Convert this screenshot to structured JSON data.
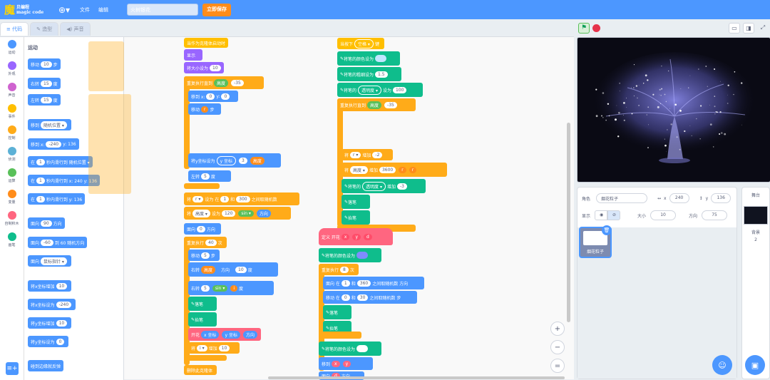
{
  "header": {
    "logo_main": "魔",
    "logo_cn": "贝编程",
    "logo_en": "magic code",
    "menu_file": "文件",
    "menu_edit": "编辑",
    "project_title": "火树银花",
    "save_label": "立即保存"
  },
  "tabs": [
    "代码",
    "造型",
    "声音"
  ],
  "categories": [
    {
      "label": "运动",
      "color": "#4c97ff"
    },
    {
      "label": "外观",
      "color": "#9966ff"
    },
    {
      "label": "声音",
      "color": "#cf63cf"
    },
    {
      "label": "事件",
      "color": "#ffbf00"
    },
    {
      "label": "控制",
      "color": "#ffab19"
    },
    {
      "label": "侦测",
      "color": "#5cb1d6"
    },
    {
      "label": "运算",
      "color": "#59c059"
    },
    {
      "label": "变量",
      "color": "#ff8c1a"
    },
    {
      "label": "自制积木",
      "color": "#ff6680"
    },
    {
      "label": "画笔",
      "color": "#0fbd8c"
    }
  ],
  "palette": {
    "title": "运动",
    "blocks": [
      {
        "t": "移动",
        "v": "10",
        "s": "步"
      },
      {
        "t": "右转",
        "v": "15",
        "s": "度"
      },
      {
        "t": "左转",
        "v": "15",
        "s": "度"
      },
      {
        "t": "移到",
        "v": "随机位置 ▾",
        "s": ""
      },
      {
        "t": "移到 x:",
        "v": "-240",
        "s": "y: 136"
      },
      {
        "t": "在",
        "v": "1",
        "s": "秒内滑行到 随机位置 ▾"
      },
      {
        "t": "在",
        "v": "1",
        "s": "秒内滑行到 x: 240 y: 136"
      },
      {
        "t": "在",
        "v": "1",
        "s": "秒内滑行到 y: 136"
      },
      {
        "t": "面向",
        "v": "90",
        "s": "方向"
      },
      {
        "t": "面向",
        "v": "-60",
        "s": "到 60 随机方向"
      },
      {
        "t": "面向",
        "v": "鼠标指针 ▾",
        "s": ""
      },
      {
        "t": "将x坐标增加",
        "v": "10",
        "s": ""
      },
      {
        "t": "将x坐标设为",
        "v": "-240",
        "s": ""
      },
      {
        "t": "将y坐标增加",
        "v": "10",
        "s": ""
      },
      {
        "t": "将y坐标设为",
        "v": "0",
        "s": ""
      },
      {
        "t": "碰到边缘就反弹",
        "v": "",
        "s": ""
      }
    ]
  },
  "script1": {
    "hat": "当作为克隆体启动时",
    "b1": "显示",
    "b2_t": "将大小设为",
    "b2_v": "10",
    "b3_t": "重复执行直到",
    "b3_v1": "高度",
    "b3_v2": "-35",
    "b4_t": "移到 x:",
    "b4_v1": "0",
    "b4_v2": "y:",
    "b4_v3": "0",
    "b5_t": "移动",
    "b5_v": "r",
    "b5_s": "步",
    "b6_t": "将y坐标设为",
    "b6_v1": "y 坐标",
    "b6_v2": "3",
    "b6_v3": "高度",
    "b7_t": "左转",
    "b7_v": "5",
    "b7_s": "度",
    "b8_t": "将",
    "b8_v1": "r ▾",
    "b8_m": "设为 在",
    "b8_v2": "1",
    "b8_m2": "和",
    "b8_v3": "300",
    "b8_s": "之间取随机数",
    "b9_t": "将",
    "b9_v1": "高度 ▾",
    "b9_m": "设为",
    "b9_v2": "120",
    "b9_v3": "sin ▾",
    "b9_v4": "方向",
    "b10_t": "面向",
    "b10_v": "0",
    "b10_s": "方向",
    "b11_t": "重复执行",
    "b11_v": "40",
    "b11_s": "次",
    "b12_t": "移动",
    "b12_v": "5",
    "b12_s": "步",
    "b13_t": "右转",
    "b13_v1": "高度",
    "b13_v2": "方向",
    "b13_v3": "10",
    "b13_s": "度",
    "b14_t": "右转",
    "b14_v1": "5",
    "b14_v2": "sin ▾",
    "b14_v3": "i",
    "b14_s": "度",
    "b15": "落笔",
    "b16": "抬笔",
    "b17_t": "开花",
    "b17_v1": "x 坐标",
    "b17_v2": "y 坐标",
    "b17_v3": "方向",
    "b18_t": "将",
    "b18_v1": "i ▾",
    "b18_m": "增加",
    "b18_v2": "10",
    "b19": "删除此克隆体"
  },
  "script2": {
    "hat_t": "当按下",
    "hat_v": "空格 ▾",
    "hat_s": "键",
    "b1": "将笔的颜色设为",
    "b2_t": "将笔的粗细设为",
    "b2_v": "1.5",
    "b3_t": "将笔的",
    "b3_v1": "透明度 ▾",
    "b3_m": "设为",
    "b3_v2": "100",
    "b4_t": "重复执行直到",
    "b4_v1": "高度",
    "b4_v2": "-35",
    "b5_t": "将",
    "b5_v1": "r ▾",
    "b5_m": "增加",
    "b5_v2": "-2",
    "b6_t": "将",
    "b6_v1": "高度 ▾",
    "b6_m": "增加",
    "b6_v2": "3600",
    "b6_v3": "r",
    "b6_v4": "r",
    "b7_t": "将笔的",
    "b7_v1": "透明度 ▾",
    "b7_m": "增加",
    "b7_v2": "-3",
    "b8": "落笔",
    "b9": "抬笔"
  },
  "script3": {
    "def_t": "定义 开花",
    "def_v1": "x",
    "def_v2": "y",
    "def_v3": "d",
    "b1": "将笔的颜色设为",
    "b2_t": "重复执行",
    "b2_v": "8",
    "b2_s": "次",
    "b3_t": "面向 在",
    "b3_v1": "1",
    "b3_m": "和",
    "b3_v2": "360",
    "b3_s": "之间取随机数 方向",
    "b4_t": "移动 在",
    "b4_v1": "0",
    "b4_m": "和",
    "b4_v2": "30",
    "b4_s": "之间取随机数 步",
    "b5": "落笔",
    "b6": "抬笔",
    "b7": "将笔的颜色设为",
    "b8_t": "移到",
    "b8_v1": "x",
    "b8_v2": "y",
    "b9_t": "面向",
    "b9_v": "d",
    "b9_s": "方向"
  },
  "stage_panel": {
    "sprite_label": "角色",
    "sprite_name": "烟花粒子",
    "x_label": "x",
    "x_value": "240",
    "y_label": "y",
    "y_value": "136",
    "show_label": "显示",
    "size_label": "大小",
    "size_value": "10",
    "dir_label": "方向",
    "dir_value": "75",
    "thumb_name": "烟花粒子",
    "stage_label": "舞台",
    "backdrop_label": "背景",
    "backdrop_count": "2"
  }
}
